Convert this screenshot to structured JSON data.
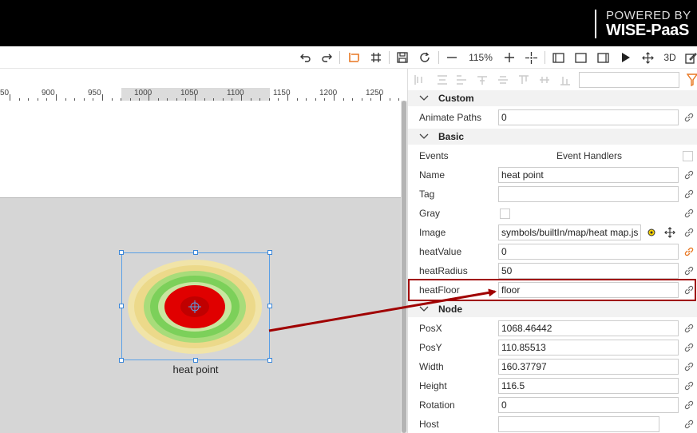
{
  "branding": {
    "line1": "POWERED BY",
    "line2": "WISE-PaaS"
  },
  "toolbar": {
    "zoom": "115%",
    "mode_3d": "3D",
    "icons": [
      "undo-icon",
      "redo-icon",
      "select-icon",
      "grid-icon",
      "save-icon",
      "refresh-icon",
      "zoom-out-icon",
      "zoom-in-icon",
      "center-icon",
      "view-1-icon",
      "view-2-icon",
      "view-3-icon",
      "play-icon",
      "move-icon",
      "3d-icon",
      "edit-icon"
    ]
  },
  "ruler": {
    "labels": [
      "50",
      "900",
      "950",
      "1000",
      "1050",
      "1100",
      "1150",
      "1200",
      "1250"
    ]
  },
  "canvas": {
    "node_label": "heat point"
  },
  "panel": {
    "sections": {
      "custom": "Custom",
      "basic": "Basic",
      "node": "Node"
    },
    "custom": {
      "animate_paths_label": "Animate Paths",
      "animate_paths_value": "0"
    },
    "basic": {
      "events_label": "Events",
      "events_handlers": "Event Handlers",
      "name_label": "Name",
      "name_value": "heat point",
      "tag_label": "Tag",
      "tag_value": "",
      "gray_label": "Gray",
      "image_label": "Image",
      "image_value": "symbols/builtIn/map/heat map.js",
      "heatvalue_label": "heatValue",
      "heatvalue_value": "0",
      "heatradius_label": "heatRadius",
      "heatradius_value": "50",
      "heatfloor_label": "heatFloor",
      "heatfloor_value": "floor"
    },
    "node": {
      "posx_label": "PosX",
      "posx_value": "1068.46442",
      "posy_label": "PosY",
      "posy_value": "110.85513",
      "width_label": "Width",
      "width_value": "160.37797",
      "height_label": "Height",
      "height_value": "116.5",
      "rotation_label": "Rotation",
      "rotation_value": "0",
      "host_label": "Host",
      "host_value": ""
    }
  },
  "colors": {
    "accent": "#e87722",
    "highlight": "#a00000",
    "selection": "#5aa0e6"
  }
}
